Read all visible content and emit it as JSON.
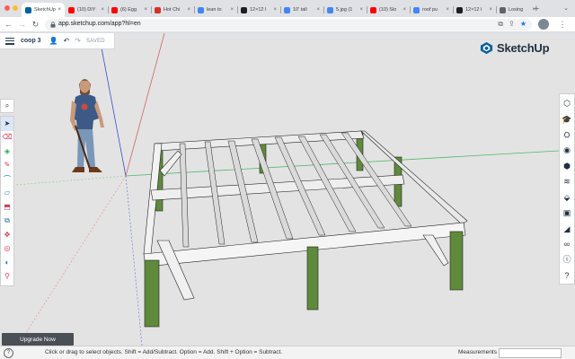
{
  "browser": {
    "tabs": [
      {
        "title": "SketchUp",
        "favicon": "sketchup-icon",
        "color": "#005f9e",
        "active": true
      },
      {
        "title": "(10) DIY",
        "favicon": "youtube-icon",
        "color": "#ff0000",
        "active": false
      },
      {
        "title": "(6) Egg",
        "favicon": "youtube-icon",
        "color": "#ff0000",
        "active": false
      },
      {
        "title": "Hot Chi",
        "favicon": "red-a-icon",
        "color": "#d93025",
        "active": false
      },
      {
        "title": "lean to",
        "favicon": "google-icon",
        "color": "#4285f4",
        "active": false
      },
      {
        "title": "12×12 l",
        "favicon": "g-icon",
        "color": "#1e1e1e",
        "active": false
      },
      {
        "title": "10' tall",
        "favicon": "google-icon",
        "color": "#4285f4",
        "active": false
      },
      {
        "title": "5.jpg (1",
        "favicon": "google-icon",
        "color": "#4285f4",
        "active": false
      },
      {
        "title": "(10) Slo",
        "favicon": "youtube-icon",
        "color": "#ff0000",
        "active": false
      },
      {
        "title": "roof pu",
        "favicon": "google-icon",
        "color": "#4285f4",
        "active": false
      },
      {
        "title": "12×12 l",
        "favicon": "g-icon",
        "color": "#1e1e1e",
        "active": false
      },
      {
        "title": "Losing",
        "favicon": "page-icon",
        "color": "#5f6368",
        "active": false
      }
    ],
    "new_tab": "+",
    "url": "app.sketchup.com/app?hl=en"
  },
  "app": {
    "model_name": "coop 3",
    "saved": "SAVED",
    "logo_text": "SketchUp",
    "upgrade": "Upgrade Now",
    "brand_color": "#005f9e"
  },
  "status": {
    "hint": "Click or drag to select objects. Shift = Add/Subtract. Option = Add. Shift + Option = Subtract.",
    "measurements_label": "Measurements",
    "measurements_value": ""
  },
  "left_tools": [
    "select-tool-icon",
    "eraser-tool-icon",
    "paint-bucket-icon",
    "pencil-line-icon",
    "arc-tool-icon",
    "rectangle-tool-icon",
    "push-pull-icon",
    "offset-icon",
    "move-tool-icon",
    "tape-measure-icon",
    "section-plane-icon",
    "walk-tool-icon"
  ],
  "right_tools": [
    "entity-info-icon",
    "instructor-icon",
    "components-icon",
    "materials-icon",
    "styles-icon",
    "layers-icon",
    "views-icon",
    "scenes-icon",
    "shadows-icon",
    "display-icon",
    "info-icon",
    "help-icon"
  ]
}
